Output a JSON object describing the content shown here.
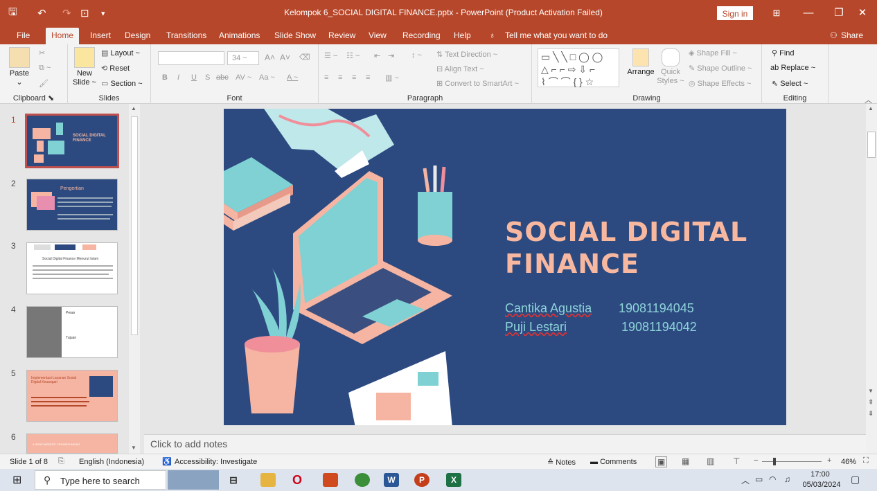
{
  "window": {
    "title": "Kelompok 6_SOCIAL DIGITAL FINANCE.pptx - PowerPoint (Product Activation Failed)",
    "sign_in": "Sign in"
  },
  "menu": {
    "tabs": [
      "File",
      "Home",
      "Insert",
      "Design",
      "Transitions",
      "Animations",
      "Slide Show",
      "Review",
      "View",
      "Recording",
      "Help"
    ],
    "tell_me": "Tell me what you want to do",
    "share": "Share"
  },
  "ribbon": {
    "clipboard": {
      "label": "Clipboard",
      "paste": "Paste"
    },
    "slides": {
      "label": "Slides",
      "new_slide": "New",
      "new_slide2": "Slide ~",
      "layout": "Layout ~",
      "reset": "Reset",
      "section": "Section ~"
    },
    "font": {
      "label": "Font",
      "size": "34"
    },
    "paragraph": {
      "label": "Paragraph",
      "text_direction": "Text Direction ~",
      "align_text": "Align Text ~",
      "convert": "Convert to SmartArt ~"
    },
    "drawing": {
      "label": "Drawing",
      "arrange": "Arrange",
      "quick_styles": "Quick",
      "quick_styles2": "Styles ~",
      "shape_fill": "Shape Fill ~",
      "shape_outline": "Shape Outline ~",
      "shape_effects": "Shape Effects ~"
    },
    "editing": {
      "label": "Editing",
      "find": "Find",
      "replace": "Replace ~",
      "select": "Select ~"
    }
  },
  "slides": [
    {
      "num": "1",
      "title": "SOCIAL DIGITAL FINANCE",
      "selected": true
    },
    {
      "num": "2",
      "title": "Pengertian"
    },
    {
      "num": "3",
      "title": "Social Digital Finance Menurut Islam"
    },
    {
      "num": "4",
      "title": "Peran",
      "subtitle": "Tujuan"
    },
    {
      "num": "5",
      "title": "Implementasi Layanan Sosial Digital Keuangan"
    },
    {
      "num": "6",
      "title": "4 JENIS WEBSITE CROWDFUNDING"
    }
  ],
  "current_slide": {
    "title_line1": "SOCIAL DIGITAL",
    "title_line2": "FINANCE",
    "members": [
      {
        "name": "Cantika Agustia",
        "id": "19081194045"
      },
      {
        "name": "Puji Lestari",
        "id": "19081194042"
      }
    ]
  },
  "notes_placeholder": "Click to add notes",
  "status": {
    "slide": "Slide 1 of 8",
    "language": "English (Indonesia)",
    "accessibility": "Accessibility: Investigate",
    "notes": "Notes",
    "comments": "Comments",
    "zoom": "46%"
  },
  "taskbar": {
    "search": "Type here to search",
    "time": "17:00",
    "date": "05/03/2024"
  }
}
